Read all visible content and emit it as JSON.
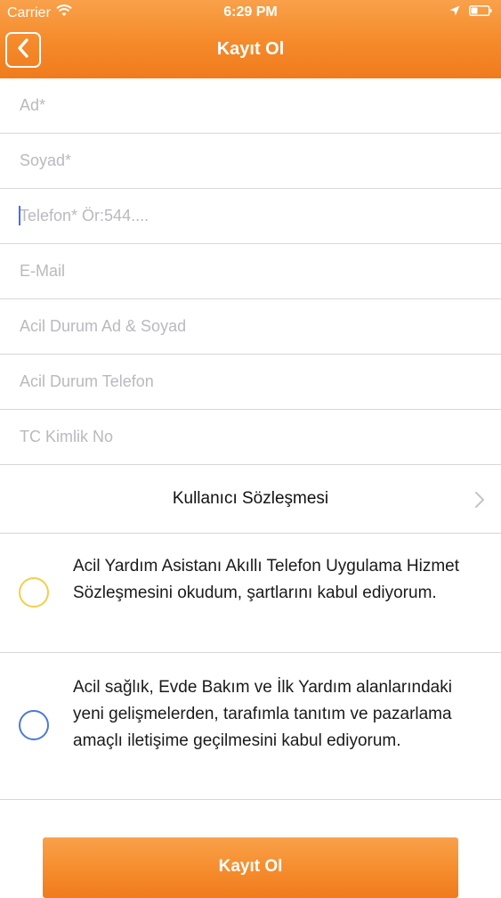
{
  "status_bar": {
    "carrier": "Carrier",
    "time": "6:29 PM",
    "icons": [
      "wifi-icon",
      "location-arrow-icon",
      "battery-icon"
    ]
  },
  "nav": {
    "title": "Kayıt Ol",
    "back_icon": "chevron-left-icon"
  },
  "form": {
    "fields": [
      {
        "name": "first-name",
        "placeholder": "Ad*",
        "value": ""
      },
      {
        "name": "last-name",
        "placeholder": "Soyad*",
        "value": ""
      },
      {
        "name": "phone",
        "placeholder": "Telefon* Ör:544....",
        "value": ""
      },
      {
        "name": "email",
        "placeholder": "E-Mail",
        "value": ""
      },
      {
        "name": "emergency-name",
        "placeholder": "Acil Durum Ad & Soyad",
        "value": ""
      },
      {
        "name": "emergency-phone",
        "placeholder": "Acil Durum Telefon",
        "value": ""
      },
      {
        "name": "tc-id",
        "placeholder": "TC Kimlik No",
        "value": ""
      }
    ]
  },
  "agreement": {
    "label": "Kullanıcı Sözleşmesi",
    "icon": "chevron-right-icon"
  },
  "consents": [
    {
      "text": "Acil Yardım Asistanı Akıllı Telefon Uygulama Hizmet Sözleşmesini okudum, şartlarını kabul ediyorum.",
      "checked": false,
      "color": "#f2cf4a"
    },
    {
      "text": "Acil sağlık, Evde Bakım ve İlk Yardım alanlarındaki yeni gelişmelerden, tarafımla tanıtım ve pazarlama amaçlı iletişime geçilmesini kabul ediyorum.",
      "checked": false,
      "color": "#4a7ad8"
    }
  ],
  "submit": {
    "label": "Kayıt Ol"
  },
  "colors": {
    "accent": "#f58a2a",
    "separator": "#d7d7d7",
    "placeholder": "#b9b9bf"
  }
}
